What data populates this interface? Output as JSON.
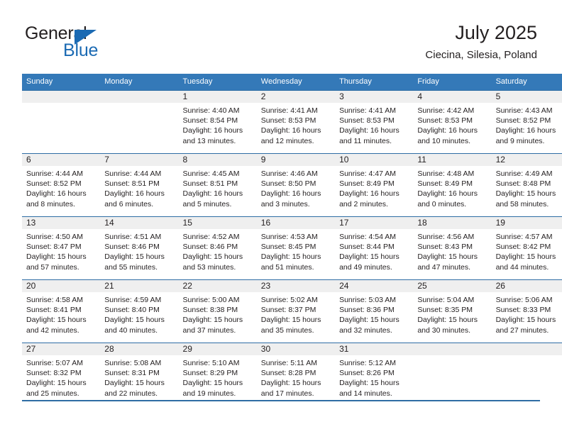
{
  "brand": {
    "name_part1": "General",
    "name_part2": "Blue",
    "triangle_color": "#1b6ab3",
    "text_color": "#231f20"
  },
  "header": {
    "title": "July 2025",
    "subtitle": "Ciecina, Silesia, Poland"
  },
  "theme": {
    "header_bg": "#3479b8",
    "rule_color": "#2e6da4",
    "daynum_bg": "#efefef",
    "body_bg": "#ffffff"
  },
  "weekdays": [
    "Sunday",
    "Monday",
    "Tuesday",
    "Wednesday",
    "Thursday",
    "Friday",
    "Saturday"
  ],
  "labels": {
    "sunrise_prefix": "Sunrise:",
    "sunset_prefix": "Sunset:",
    "daylight_prefix": "Daylight:"
  },
  "weeks": [
    [
      {
        "day": "",
        "l1": "",
        "l2": "",
        "l3": "",
        "l4": ""
      },
      {
        "day": "",
        "l1": "",
        "l2": "",
        "l3": "",
        "l4": ""
      },
      {
        "day": "1",
        "l1": "Sunrise: 4:40 AM",
        "l2": "Sunset: 8:54 PM",
        "l3": "Daylight: 16 hours",
        "l4": "and 13 minutes."
      },
      {
        "day": "2",
        "l1": "Sunrise: 4:41 AM",
        "l2": "Sunset: 8:53 PM",
        "l3": "Daylight: 16 hours",
        "l4": "and 12 minutes."
      },
      {
        "day": "3",
        "l1": "Sunrise: 4:41 AM",
        "l2": "Sunset: 8:53 PM",
        "l3": "Daylight: 16 hours",
        "l4": "and 11 minutes."
      },
      {
        "day": "4",
        "l1": "Sunrise: 4:42 AM",
        "l2": "Sunset: 8:53 PM",
        "l3": "Daylight: 16 hours",
        "l4": "and 10 minutes."
      },
      {
        "day": "5",
        "l1": "Sunrise: 4:43 AM",
        "l2": "Sunset: 8:52 PM",
        "l3": "Daylight: 16 hours",
        "l4": "and 9 minutes."
      }
    ],
    [
      {
        "day": "6",
        "l1": "Sunrise: 4:44 AM",
        "l2": "Sunset: 8:52 PM",
        "l3": "Daylight: 16 hours",
        "l4": "and 8 minutes."
      },
      {
        "day": "7",
        "l1": "Sunrise: 4:44 AM",
        "l2": "Sunset: 8:51 PM",
        "l3": "Daylight: 16 hours",
        "l4": "and 6 minutes."
      },
      {
        "day": "8",
        "l1": "Sunrise: 4:45 AM",
        "l2": "Sunset: 8:51 PM",
        "l3": "Daylight: 16 hours",
        "l4": "and 5 minutes."
      },
      {
        "day": "9",
        "l1": "Sunrise: 4:46 AM",
        "l2": "Sunset: 8:50 PM",
        "l3": "Daylight: 16 hours",
        "l4": "and 3 minutes."
      },
      {
        "day": "10",
        "l1": "Sunrise: 4:47 AM",
        "l2": "Sunset: 8:49 PM",
        "l3": "Daylight: 16 hours",
        "l4": "and 2 minutes."
      },
      {
        "day": "11",
        "l1": "Sunrise: 4:48 AM",
        "l2": "Sunset: 8:49 PM",
        "l3": "Daylight: 16 hours",
        "l4": "and 0 minutes."
      },
      {
        "day": "12",
        "l1": "Sunrise: 4:49 AM",
        "l2": "Sunset: 8:48 PM",
        "l3": "Daylight: 15 hours",
        "l4": "and 58 minutes."
      }
    ],
    [
      {
        "day": "13",
        "l1": "Sunrise: 4:50 AM",
        "l2": "Sunset: 8:47 PM",
        "l3": "Daylight: 15 hours",
        "l4": "and 57 minutes."
      },
      {
        "day": "14",
        "l1": "Sunrise: 4:51 AM",
        "l2": "Sunset: 8:46 PM",
        "l3": "Daylight: 15 hours",
        "l4": "and 55 minutes."
      },
      {
        "day": "15",
        "l1": "Sunrise: 4:52 AM",
        "l2": "Sunset: 8:46 PM",
        "l3": "Daylight: 15 hours",
        "l4": "and 53 minutes."
      },
      {
        "day": "16",
        "l1": "Sunrise: 4:53 AM",
        "l2": "Sunset: 8:45 PM",
        "l3": "Daylight: 15 hours",
        "l4": "and 51 minutes."
      },
      {
        "day": "17",
        "l1": "Sunrise: 4:54 AM",
        "l2": "Sunset: 8:44 PM",
        "l3": "Daylight: 15 hours",
        "l4": "and 49 minutes."
      },
      {
        "day": "18",
        "l1": "Sunrise: 4:56 AM",
        "l2": "Sunset: 8:43 PM",
        "l3": "Daylight: 15 hours",
        "l4": "and 47 minutes."
      },
      {
        "day": "19",
        "l1": "Sunrise: 4:57 AM",
        "l2": "Sunset: 8:42 PM",
        "l3": "Daylight: 15 hours",
        "l4": "and 44 minutes."
      }
    ],
    [
      {
        "day": "20",
        "l1": "Sunrise: 4:58 AM",
        "l2": "Sunset: 8:41 PM",
        "l3": "Daylight: 15 hours",
        "l4": "and 42 minutes."
      },
      {
        "day": "21",
        "l1": "Sunrise: 4:59 AM",
        "l2": "Sunset: 8:40 PM",
        "l3": "Daylight: 15 hours",
        "l4": "and 40 minutes."
      },
      {
        "day": "22",
        "l1": "Sunrise: 5:00 AM",
        "l2": "Sunset: 8:38 PM",
        "l3": "Daylight: 15 hours",
        "l4": "and 37 minutes."
      },
      {
        "day": "23",
        "l1": "Sunrise: 5:02 AM",
        "l2": "Sunset: 8:37 PM",
        "l3": "Daylight: 15 hours",
        "l4": "and 35 minutes."
      },
      {
        "day": "24",
        "l1": "Sunrise: 5:03 AM",
        "l2": "Sunset: 8:36 PM",
        "l3": "Daylight: 15 hours",
        "l4": "and 32 minutes."
      },
      {
        "day": "25",
        "l1": "Sunrise: 5:04 AM",
        "l2": "Sunset: 8:35 PM",
        "l3": "Daylight: 15 hours",
        "l4": "and 30 minutes."
      },
      {
        "day": "26",
        "l1": "Sunrise: 5:06 AM",
        "l2": "Sunset: 8:33 PM",
        "l3": "Daylight: 15 hours",
        "l4": "and 27 minutes."
      }
    ],
    [
      {
        "day": "27",
        "l1": "Sunrise: 5:07 AM",
        "l2": "Sunset: 8:32 PM",
        "l3": "Daylight: 15 hours",
        "l4": "and 25 minutes."
      },
      {
        "day": "28",
        "l1": "Sunrise: 5:08 AM",
        "l2": "Sunset: 8:31 PM",
        "l3": "Daylight: 15 hours",
        "l4": "and 22 minutes."
      },
      {
        "day": "29",
        "l1": "Sunrise: 5:10 AM",
        "l2": "Sunset: 8:29 PM",
        "l3": "Daylight: 15 hours",
        "l4": "and 19 minutes."
      },
      {
        "day": "30",
        "l1": "Sunrise: 5:11 AM",
        "l2": "Sunset: 8:28 PM",
        "l3": "Daylight: 15 hours",
        "l4": "and 17 minutes."
      },
      {
        "day": "31",
        "l1": "Sunrise: 5:12 AM",
        "l2": "Sunset: 8:26 PM",
        "l3": "Daylight: 15 hours",
        "l4": "and 14 minutes."
      },
      {
        "day": "",
        "l1": "",
        "l2": "",
        "l3": "",
        "l4": ""
      },
      {
        "day": "",
        "l1": "",
        "l2": "",
        "l3": "",
        "l4": ""
      }
    ]
  ]
}
